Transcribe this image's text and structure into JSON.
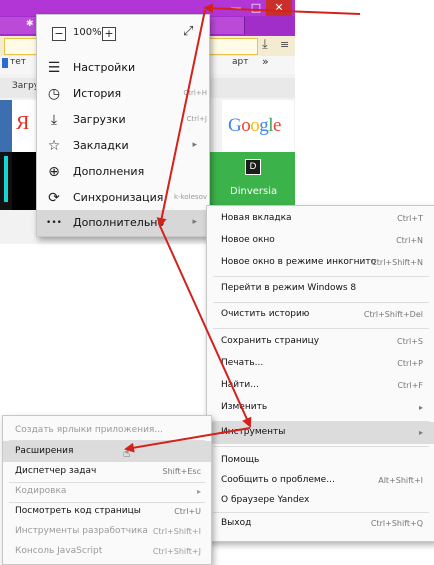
{
  "background": {
    "bookmarks_fragments": [
      "тет",
      "арт",
      "»"
    ],
    "address_fragment": "Загрузк",
    "tiles": {
      "google_logo": "Google",
      "dinversia_label": "Dinversia",
      "yandex_letter": "Я"
    },
    "window_controls": [
      "—",
      "□",
      "✕"
    ]
  },
  "main_menu": {
    "zoom_minus": "−",
    "zoom_level": "100%",
    "zoom_plus": "+",
    "items": [
      {
        "label": "Настройки",
        "icon": "settings-sliders-icon",
        "glyph": "☰",
        "shortcut": "",
        "arrow": ""
      },
      {
        "label": "История",
        "icon": "history-clock-icon",
        "glyph": "◷",
        "shortcut": "Ctrl+H",
        "arrow": ""
      },
      {
        "label": "Загрузки",
        "icon": "download-icon",
        "glyph": "⤓",
        "shortcut": "Ctrl+J",
        "arrow": ""
      },
      {
        "label": "Закладки",
        "icon": "star-icon",
        "glyph": "☆",
        "shortcut": "",
        "arrow": "▸"
      },
      {
        "label": "Дополнения",
        "icon": "add-circle-icon",
        "glyph": "⊕",
        "shortcut": "",
        "arrow": ""
      },
      {
        "label": "Синхронизация",
        "icon": "sync-icon",
        "glyph": "⟳",
        "shortcut": "k-kolesov",
        "arrow": ""
      },
      {
        "label": "Дополнительно",
        "icon": "more-dots-icon",
        "glyph": "•••",
        "shortcut": "",
        "arrow": "▸"
      }
    ]
  },
  "more_menu": {
    "items": [
      {
        "label": "Новая вкладка",
        "shortcut": "Ctrl+T"
      },
      {
        "label": "Новое окно",
        "shortcut": "Ctrl+N"
      },
      {
        "label": "Новое окно в режиме инкогнито",
        "shortcut": "Ctrl+Shift+N"
      },
      {
        "label": "Перейти в режим Windows 8",
        "shortcut": ""
      },
      {
        "label": "Очистить историю",
        "shortcut": "Ctrl+Shift+Del"
      },
      {
        "label": "Сохранить страницу",
        "shortcut": "Ctrl+S"
      },
      {
        "label": "Печать...",
        "shortcut": "Ctrl+P"
      },
      {
        "label": "Найти...",
        "shortcut": "Ctrl+F"
      },
      {
        "label": "Изменить",
        "shortcut": "▸"
      },
      {
        "label": "Инструменты",
        "shortcut": "▸"
      },
      {
        "label": "Помощь",
        "shortcut": ""
      },
      {
        "label": "Сообщить о проблеме...",
        "shortcut": "Alt+Shift+I"
      },
      {
        "label": "О браузере Yandex",
        "shortcut": ""
      },
      {
        "label": "Выход",
        "shortcut": "Ctrl+Shift+Q"
      }
    ]
  },
  "tools_menu": {
    "items": [
      {
        "label": "Создать ярлыки приложения...",
        "shortcut": "",
        "disabled": true
      },
      {
        "label": "Расширения",
        "shortcut": "",
        "disabled": false
      },
      {
        "label": "Диспетчер задач",
        "shortcut": "Shift+Esc",
        "disabled": false
      },
      {
        "label": "Кодировка",
        "shortcut": "▸",
        "disabled": true
      },
      {
        "label": "Посмотреть код страницы",
        "shortcut": "Ctrl+U",
        "disabled": false
      },
      {
        "label": "Инструменты разработчика",
        "shortcut": "Ctrl+Shift+I",
        "disabled": true
      },
      {
        "label": "Консоль JavaScript",
        "shortcut": "Ctrl+Shift+J",
        "disabled": true
      }
    ]
  },
  "colors": {
    "titlebar": "#b236d6",
    "annotation_arrow": "#d4211b",
    "dinversia_tile": "#3cb34a"
  }
}
